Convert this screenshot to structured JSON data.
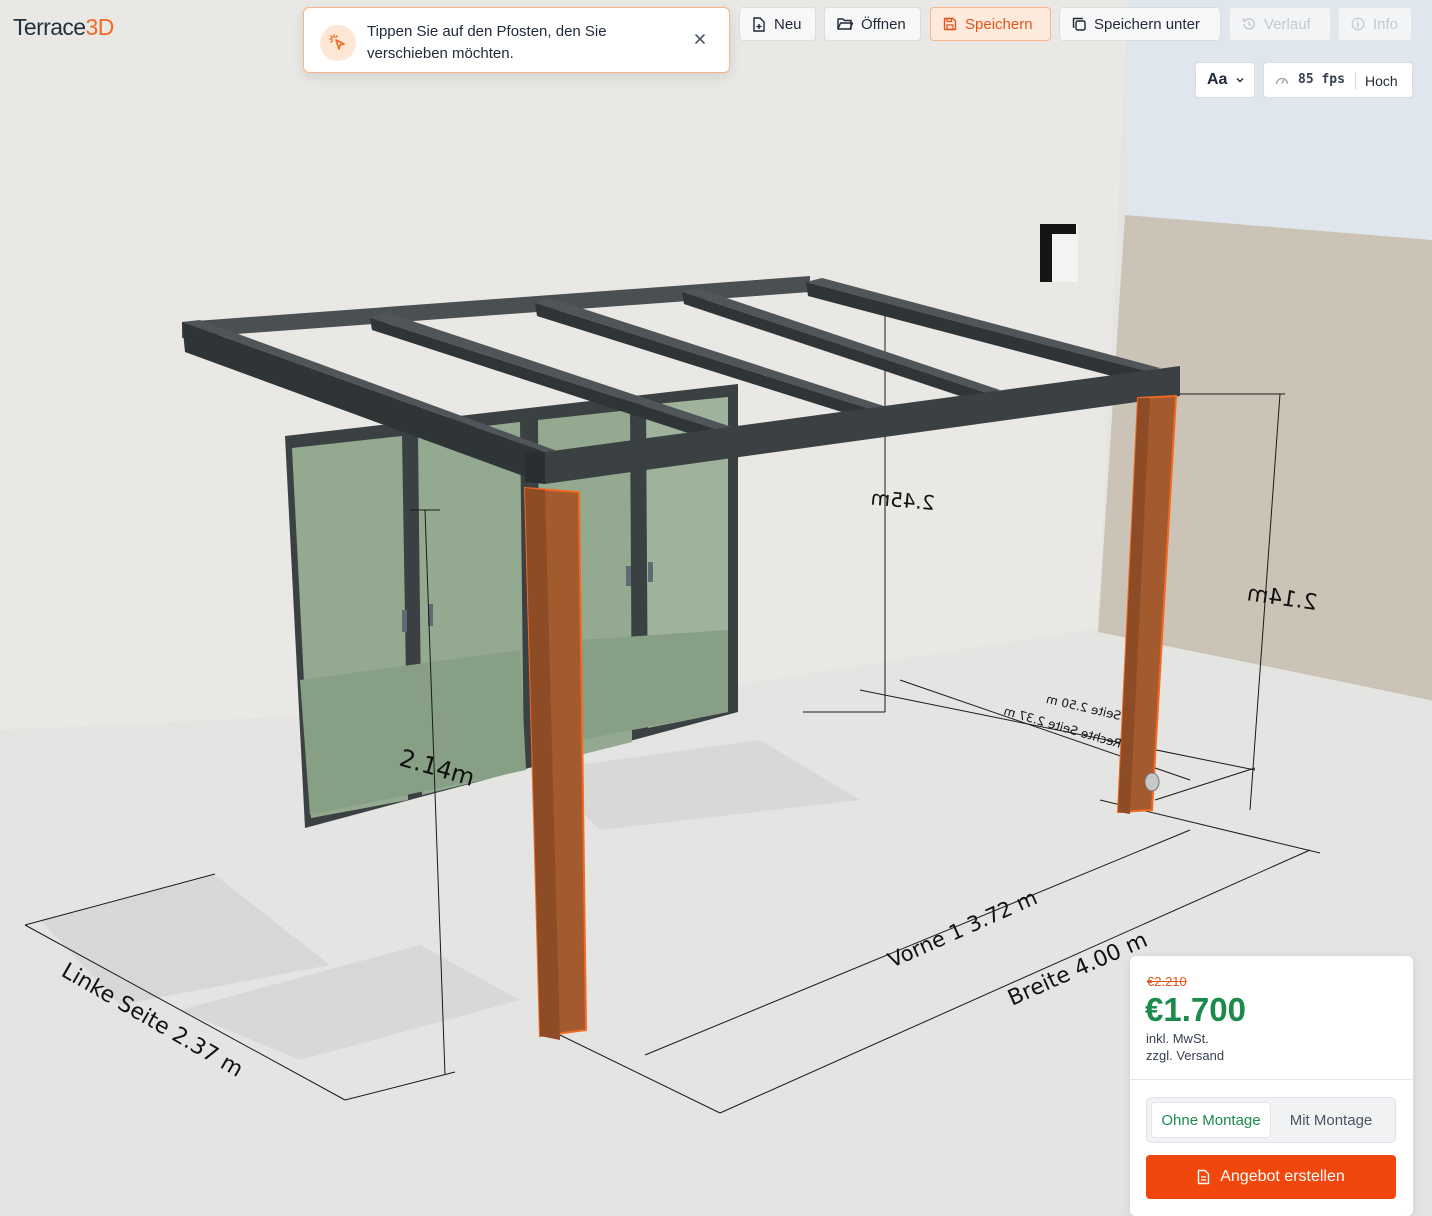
{
  "app": {
    "logo_main": "Terrace",
    "logo_accent": "3D"
  },
  "toast": {
    "message": "Tippen Sie auf den Pfosten, den Sie verschieben möchten.",
    "icon": "pointer-click-icon",
    "close_icon": "close-icon"
  },
  "toolbar": {
    "new_label": "Neu",
    "open_label": "Öffnen",
    "save_label": "Speichern",
    "save_as_label": "Speichern unter",
    "history_label": "Verlauf",
    "info_label": "Info"
  },
  "view": {
    "font_toggle": "Aa",
    "fps": "85 fps",
    "quality": "Hoch"
  },
  "dimensions": {
    "left_side": "Linke Seite  2.37 m",
    "front": "Vorne 1  3.72 m",
    "width": "Breite  4.00 m",
    "height_back": "2.45m",
    "height_front_left": "2.14m",
    "height_front_right": "2.14m",
    "right_side_1": "Rechte Seite  2.37 m",
    "right_side_2": "Seite  2.50 m"
  },
  "price": {
    "old": "€2.210",
    "current": "€1.700",
    "vat_note": "inkl. MwSt.",
    "shipping_note": "zzgl. Versand",
    "option_without": "Ohne Montage",
    "option_with": "Mit Montage",
    "cta_label": "Angebot erstellen"
  },
  "colors": {
    "accent": "#f2470c",
    "price_green": "#1b8a4d",
    "frame": "#3b4042",
    "post": "#a65a2e",
    "post_outline": "#f26a22"
  }
}
